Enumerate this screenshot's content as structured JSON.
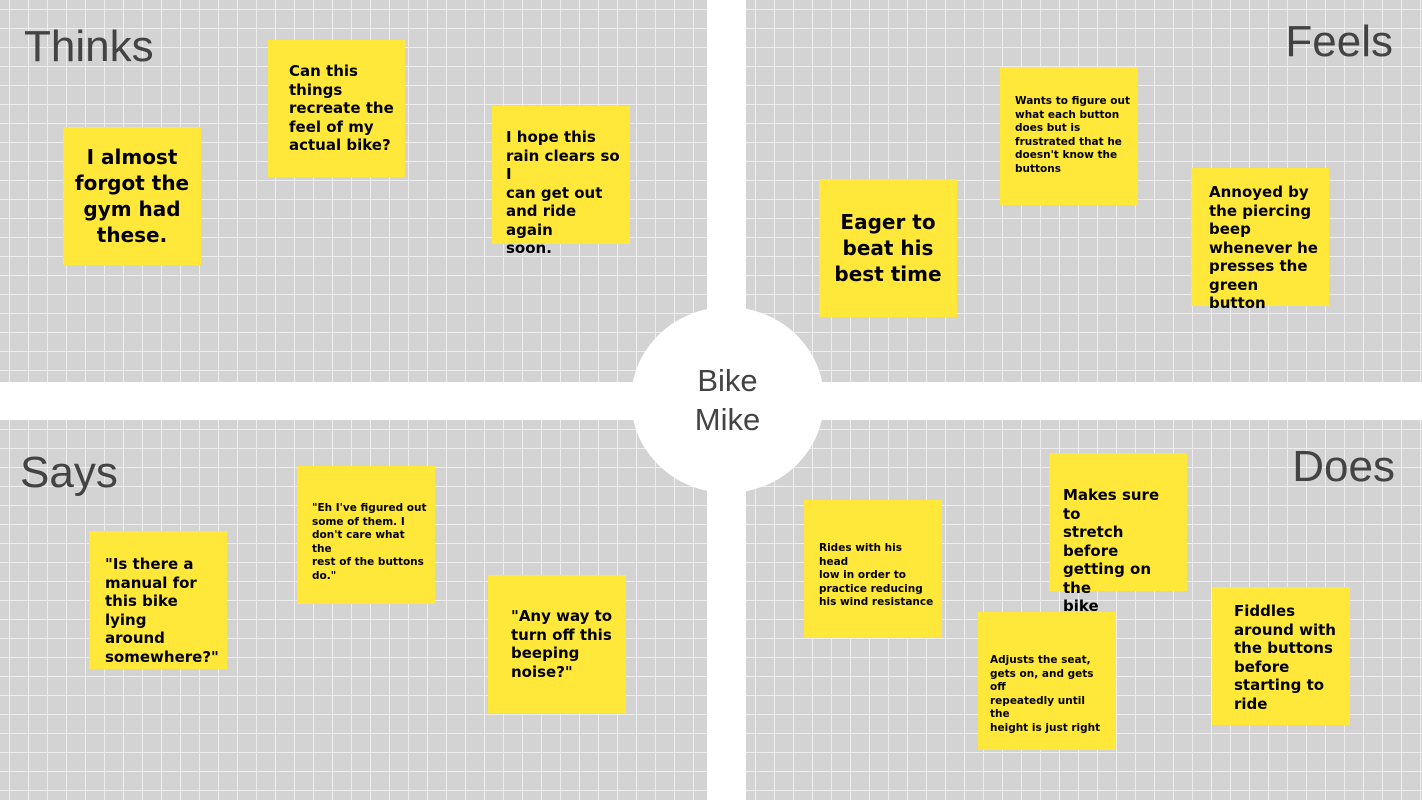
{
  "persona": {
    "line1": "Bike",
    "line2": "Mike"
  },
  "quadrants": {
    "thinks": {
      "label": "Thinks"
    },
    "feels": {
      "label": "Feels"
    },
    "says": {
      "label": "Says"
    },
    "does": {
      "label": "Does"
    }
  },
  "notes": {
    "thinks": [
      {
        "lines": [
          "I almost",
          "forgot the",
          "gym had",
          "these."
        ]
      },
      {
        "lines": [
          "Can this",
          "things",
          "recreate the",
          "feel of my",
          "actual bike?"
        ]
      },
      {
        "lines": [
          "I hope this",
          "rain clears so I",
          "can get out",
          "and ride again",
          "soon."
        ]
      }
    ],
    "feels": [
      {
        "lines": [
          "Eager to",
          "beat his",
          "best time"
        ]
      },
      {
        "lines": [
          "Wants to figure out",
          "what each button",
          "does but is",
          "frustrated that he",
          "doesn't know the",
          "buttons"
        ]
      },
      {
        "lines": [
          "Annoyed by",
          "the piercing",
          "beep",
          "whenever he",
          "presses the",
          "green button"
        ]
      }
    ],
    "says": [
      {
        "lines": [
          "\"Is there a",
          "manual for",
          "this bike lying",
          "around",
          "somewhere?\""
        ]
      },
      {
        "lines": [
          "\"Eh I've figured out",
          "some of them. I",
          "don't care what the",
          "rest of the buttons",
          "do.\""
        ]
      },
      {
        "lines": [
          "\"Any way to",
          "turn off this",
          "beeping",
          "noise?\""
        ]
      }
    ],
    "does": [
      {
        "lines": [
          "Rides with his head",
          "low in order to",
          "practice reducing",
          "his wind resistance"
        ]
      },
      {
        "lines": [
          "Makes sure to",
          "stretch before",
          "getting on the",
          "bike"
        ]
      },
      {
        "lines": [
          "Adjusts the seat,",
          "gets on, and gets off",
          "repeatedly until the",
          "height is just right"
        ]
      },
      {
        "lines": [
          "Fiddles",
          "around with",
          "the buttons",
          "before",
          "starting to",
          "ride"
        ]
      }
    ]
  },
  "colors": {
    "note": "#ffe83a",
    "quadrant_bg": "#d3d3d3",
    "grid_line": "#eeeeee",
    "label_text": "#434343",
    "divider": "#ffffff"
  }
}
